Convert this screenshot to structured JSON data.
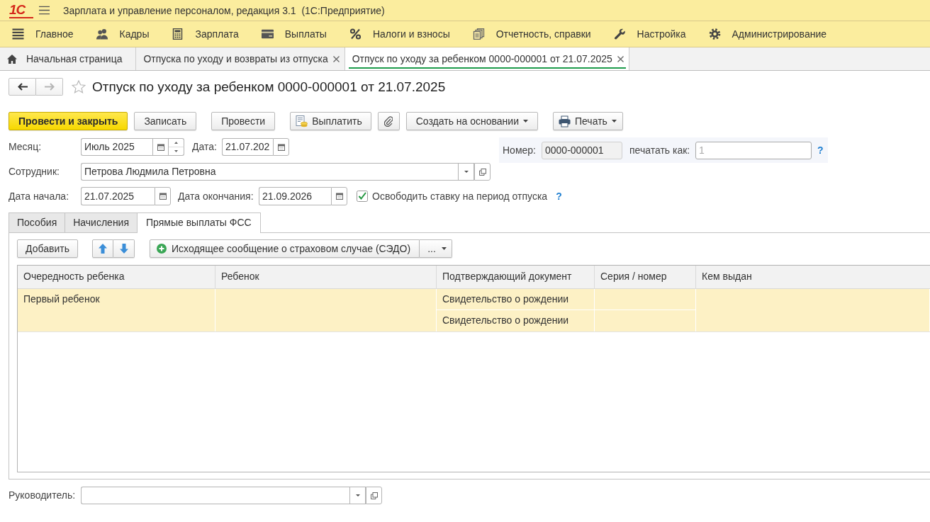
{
  "window": {
    "logo": "1С",
    "title": "Зарплата и управление персоналом, редакция 3.1  (1С:Предприятие)"
  },
  "sections": [
    {
      "kind": "main",
      "label": "Главное"
    },
    {
      "kind": "hr",
      "label": "Кадры"
    },
    {
      "kind": "salary",
      "label": "Зарплата"
    },
    {
      "kind": "payments",
      "label": "Выплаты"
    },
    {
      "kind": "taxes",
      "label": "Налоги и взносы"
    },
    {
      "kind": "reports",
      "label": "Отчетность, справки"
    },
    {
      "kind": "settings",
      "label": "Настройка"
    },
    {
      "kind": "admin",
      "label": "Администрирование"
    }
  ],
  "tabs": [
    {
      "kind": "home",
      "label": "Начальная страница",
      "selected": false
    },
    {
      "kind": "document",
      "label": "Отпуска по уходу и возвраты из отпуска",
      "selected": false
    },
    {
      "kind": "document",
      "label": "Отпуск по уходу за ребенком 0000-000001 от 21.07.2025",
      "selected": true
    }
  ],
  "navigation": [
    {
      "kind": "back",
      "disabled": false
    },
    {
      "kind": "forward",
      "disabled": true
    }
  ],
  "document": {
    "favorite": false,
    "title": "Отпуск по уходу за ребенком 0000-000001 от 21.07.2025"
  },
  "commands": [
    {
      "kind": "primary",
      "label": "Провести и закрыть"
    },
    {
      "kind": "plain",
      "label": "Записать"
    },
    {
      "kind": "plain",
      "label": "Провести"
    },
    {
      "kind": "pay",
      "label": "Выплатить"
    },
    {
      "kind": "attach"
    },
    {
      "kind": "menu",
      "label": "Создать на основании"
    },
    {
      "kind": "print",
      "label": "Печать"
    }
  ],
  "fields": {
    "month": {
      "label": "Месяц:",
      "value": "Июль 2025"
    },
    "date": {
      "label": "Дата:",
      "value": "21.07.202"
    },
    "number": {
      "label": "Номер:",
      "value": "0000-000001",
      "disabled": true
    },
    "print_as": {
      "label": "печатать как:",
      "placeholder": "1",
      "help": "?"
    },
    "employee": {
      "label": "Сотрудник:",
      "value": "Петрова Людмила Петровна"
    },
    "start_date": {
      "label": "Дата начала:",
      "value": "21.07.2025"
    },
    "end_date": {
      "label": "Дата окончания:",
      "value": "21.09.2026"
    },
    "release_rate": {
      "label": "Освободить ставку на период отпуска",
      "checked": true,
      "help": "?"
    },
    "manager": {
      "label": "Руководитель:"
    }
  },
  "form_tabs": [
    {
      "label": "Пособия",
      "selected": false
    },
    {
      "label": "Начисления",
      "selected": false
    },
    {
      "label": "Прямые выплаты ФСС",
      "selected": true
    }
  ],
  "table_toolbar": {
    "add": "Добавить",
    "sedo": "Исходящее сообщение о страховом случае (СЭДО)",
    "more": "..."
  },
  "table": {
    "columns": [
      "Очередность ребенка",
      "Ребенок",
      "Подтверждающий документ",
      "Серия / номер",
      "Кем выдан"
    ],
    "rows": [
      {
        "selected": true,
        "order": "Первый ребенок",
        "documents": [
          {
            "document": "Свидетельство о рождении"
          },
          {
            "document": "Свидетельство о рождении"
          }
        ]
      }
    ]
  }
}
